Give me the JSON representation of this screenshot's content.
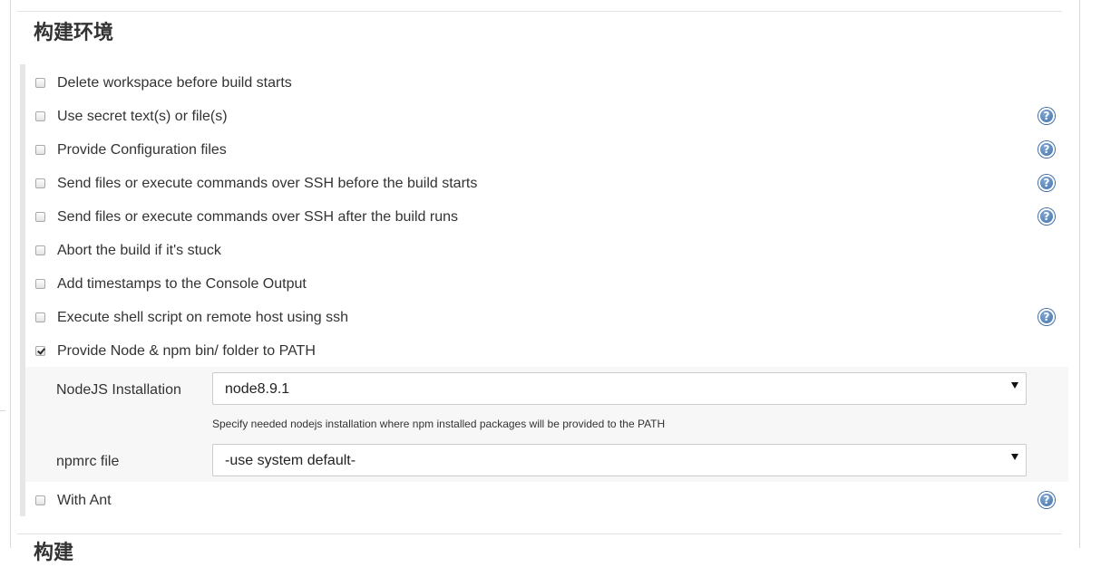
{
  "section": {
    "title": "构建环境",
    "next_title": "构建"
  },
  "options": [
    {
      "label": "Delete workspace before build starts",
      "checked": false,
      "help": false
    },
    {
      "label": "Use secret text(s) or file(s)",
      "checked": false,
      "help": true
    },
    {
      "label": "Provide Configuration files",
      "checked": false,
      "help": true
    },
    {
      "label": "Send files or execute commands over SSH before the build starts",
      "checked": false,
      "help": true
    },
    {
      "label": "Send files or execute commands over SSH after the build runs",
      "checked": false,
      "help": true
    },
    {
      "label": "Abort the build if it's stuck",
      "checked": false,
      "help": false
    },
    {
      "label": "Add timestamps to the Console Output",
      "checked": false,
      "help": false
    },
    {
      "label": "Execute shell script on remote host using ssh",
      "checked": false,
      "help": true
    },
    {
      "label": "Provide Node & npm bin/ folder to PATH",
      "checked": true,
      "help": false
    },
    {
      "label": "With Ant",
      "checked": false,
      "help": true
    }
  ],
  "nodejs": {
    "installation_label": "NodeJS Installation",
    "installation_value": "node8.9.1",
    "installation_hint": "Specify needed nodejs installation where npm installed packages will be provided to the PATH",
    "npmrc_label": "npmrc file",
    "npmrc_value": "-use system default-"
  },
  "help_glyph": "?",
  "icons": {
    "help": "help-icon",
    "dropdown": "chevron-down-icon",
    "check": "checkmark-icon"
  },
  "colors": {
    "help_icon": "#3b6aa3",
    "nested_background": "#f7f7f7",
    "section_bar": "#e6e6e6"
  }
}
